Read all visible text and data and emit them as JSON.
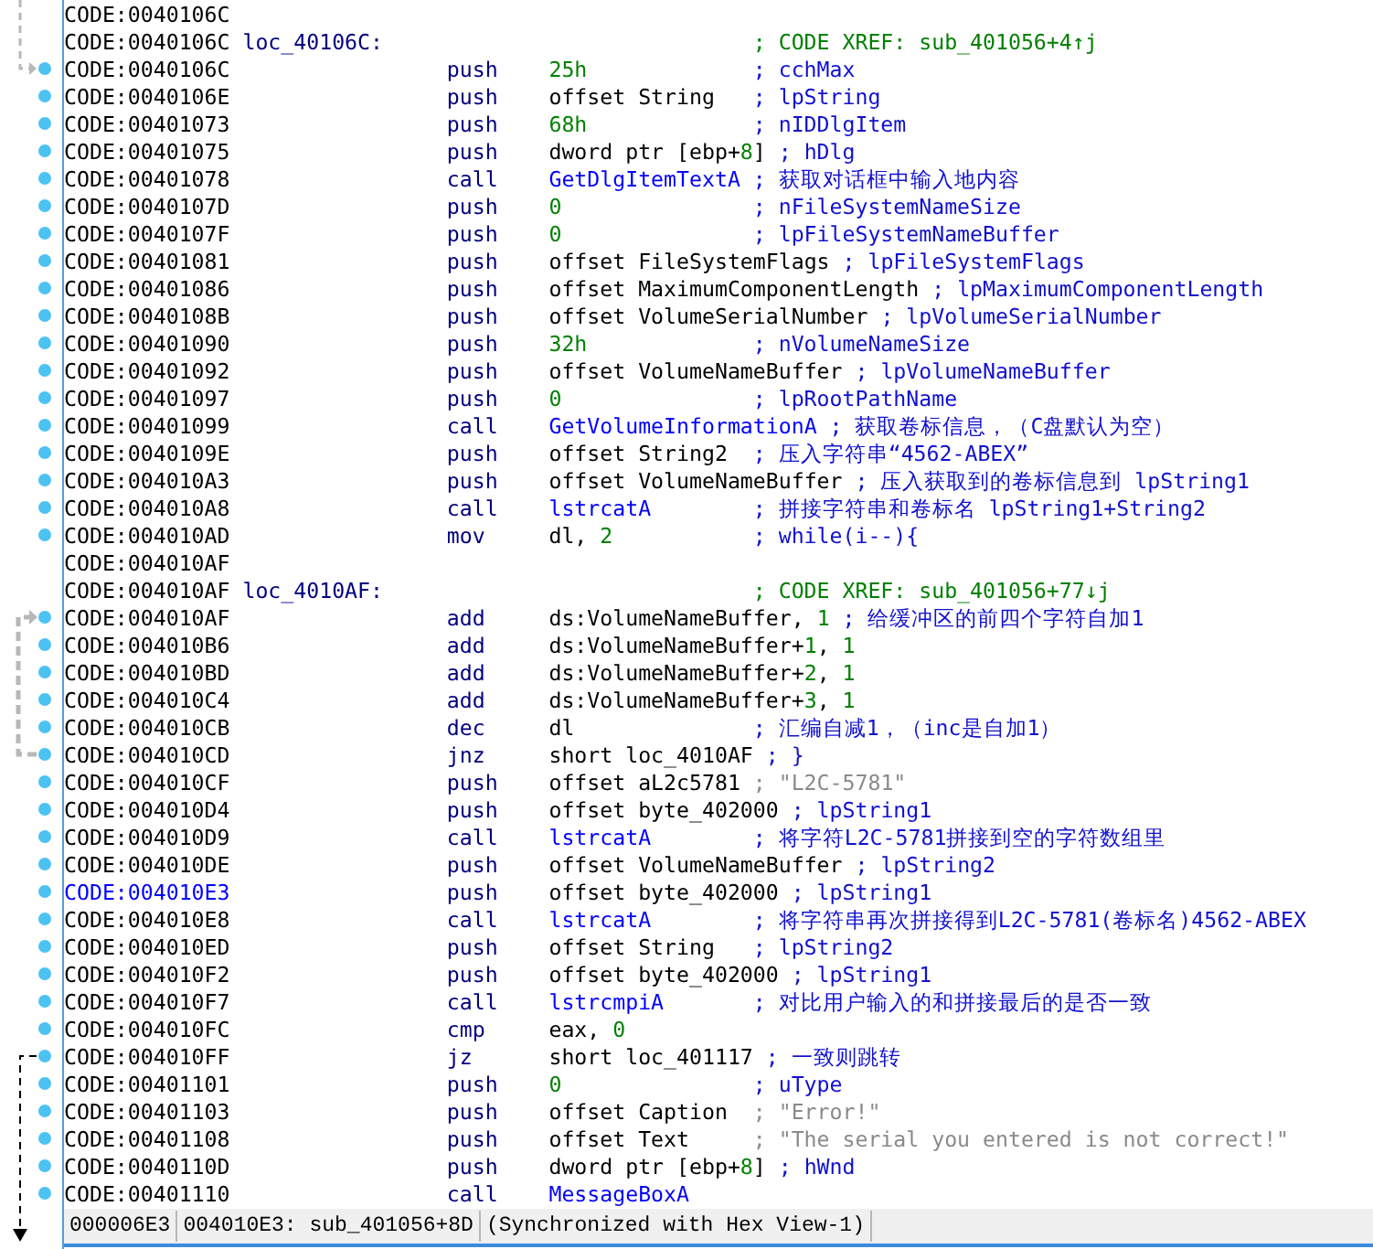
{
  "rows": [
    {
      "address": "CODE:0040106C",
      "selected": false,
      "dot": false
    },
    {
      "address": "CODE:0040106C",
      "selected": false,
      "dot": false,
      "label": "loc_40106C:",
      "comment": {
        "text": "; CODE XREF: sub_401056+4↑j",
        "kind": "xref"
      }
    },
    {
      "address": "CODE:0040106C",
      "selected": false,
      "dot": true,
      "mnemonic": "push",
      "operand": [
        {
          "text": "25h",
          "kind": "number"
        }
      ],
      "comment": {
        "text": "; cchMax",
        "kind": "note"
      }
    },
    {
      "address": "CODE:0040106E",
      "selected": false,
      "dot": true,
      "mnemonic": "push",
      "operand": [
        {
          "text": "offset String",
          "kind": "plain"
        }
      ],
      "comment": {
        "text": "; lpString",
        "kind": "note"
      }
    },
    {
      "address": "CODE:00401073",
      "selected": false,
      "dot": true,
      "mnemonic": "push",
      "operand": [
        {
          "text": "68h",
          "kind": "number"
        }
      ],
      "comment": {
        "text": "; nIDDlgItem",
        "kind": "note"
      }
    },
    {
      "address": "CODE:00401075",
      "selected": false,
      "dot": true,
      "mnemonic": "push",
      "operand": [
        {
          "text": "dword ptr [ebp+",
          "kind": "plain"
        },
        {
          "text": "8",
          "kind": "number"
        },
        {
          "text": "]",
          "kind": "plain"
        }
      ],
      "comment": {
        "text": "; hDlg",
        "kind": "note"
      }
    },
    {
      "address": "CODE:00401078",
      "selected": false,
      "dot": true,
      "mnemonic": "call",
      "operand": [
        {
          "text": "GetDlgItemTextA",
          "kind": "name"
        }
      ],
      "comment": {
        "text": "; 获取对话框中输入地内容",
        "kind": "note"
      }
    },
    {
      "address": "CODE:0040107D",
      "selected": false,
      "dot": true,
      "mnemonic": "push",
      "operand": [
        {
          "text": "0",
          "kind": "number"
        }
      ],
      "comment": {
        "text": "; nFileSystemNameSize",
        "kind": "note"
      }
    },
    {
      "address": "CODE:0040107F",
      "selected": false,
      "dot": true,
      "mnemonic": "push",
      "operand": [
        {
          "text": "0",
          "kind": "number"
        }
      ],
      "comment": {
        "text": "; lpFileSystemNameBuffer",
        "kind": "note"
      }
    },
    {
      "address": "CODE:00401081",
      "selected": false,
      "dot": true,
      "mnemonic": "push",
      "operand": [
        {
          "text": "offset FileSystemFlags",
          "kind": "plain"
        }
      ],
      "comment": {
        "text": "; lpFileSystemFlags",
        "kind": "note"
      }
    },
    {
      "address": "CODE:00401086",
      "selected": false,
      "dot": true,
      "mnemonic": "push",
      "operand": [
        {
          "text": "offset MaximumComponentLength",
          "kind": "plain"
        }
      ],
      "comment": {
        "text": "; lpMaximumComponentLength",
        "kind": "note"
      }
    },
    {
      "address": "CODE:0040108B",
      "selected": false,
      "dot": true,
      "mnemonic": "push",
      "operand": [
        {
          "text": "offset VolumeSerialNumber",
          "kind": "plain"
        }
      ],
      "comment": {
        "text": "; lpVolumeSerialNumber",
        "kind": "note"
      }
    },
    {
      "address": "CODE:00401090",
      "selected": false,
      "dot": true,
      "mnemonic": "push",
      "operand": [
        {
          "text": "32h",
          "kind": "number"
        }
      ],
      "comment": {
        "text": "; nVolumeNameSize",
        "kind": "note"
      }
    },
    {
      "address": "CODE:00401092",
      "selected": false,
      "dot": true,
      "mnemonic": "push",
      "operand": [
        {
          "text": "offset VolumeNameBuffer",
          "kind": "plain"
        }
      ],
      "comment": {
        "text": "; lpVolumeNameBuffer",
        "kind": "note"
      }
    },
    {
      "address": "CODE:00401097",
      "selected": false,
      "dot": true,
      "mnemonic": "push",
      "operand": [
        {
          "text": "0",
          "kind": "number"
        }
      ],
      "comment": {
        "text": "; lpRootPathName",
        "kind": "note"
      }
    },
    {
      "address": "CODE:00401099",
      "selected": false,
      "dot": true,
      "mnemonic": "call",
      "operand": [
        {
          "text": "GetVolumeInformationA",
          "kind": "name"
        }
      ],
      "comment": {
        "text": "; 获取卷标信息，（C盘默认为空）",
        "kind": "note"
      }
    },
    {
      "address": "CODE:0040109E",
      "selected": false,
      "dot": true,
      "mnemonic": "push",
      "operand": [
        {
          "text": "offset String2",
          "kind": "plain"
        }
      ],
      "comment": {
        "text": "; 压入字符串“4562-ABEX”",
        "kind": "note"
      }
    },
    {
      "address": "CODE:004010A3",
      "selected": false,
      "dot": true,
      "mnemonic": "push",
      "operand": [
        {
          "text": "offset VolumeNameBuffer",
          "kind": "plain"
        }
      ],
      "comment": {
        "text": "; 压入获取到的卷标信息到 lpString1",
        "kind": "note"
      }
    },
    {
      "address": "CODE:004010A8",
      "selected": false,
      "dot": true,
      "mnemonic": "call",
      "operand": [
        {
          "text": "lstrcatA",
          "kind": "name"
        }
      ],
      "comment": {
        "text": "; 拼接字符串和卷标名 lpString1+String2",
        "kind": "note"
      }
    },
    {
      "address": "CODE:004010AD",
      "selected": false,
      "dot": true,
      "mnemonic": "mov",
      "operand": [
        {
          "text": "dl, ",
          "kind": "plain"
        },
        {
          "text": "2",
          "kind": "number"
        }
      ],
      "comment": {
        "text": "; while(i--){",
        "kind": "note"
      }
    },
    {
      "address": "CODE:004010AF",
      "selected": false,
      "dot": false
    },
    {
      "address": "CODE:004010AF",
      "selected": false,
      "dot": false,
      "label": "loc_4010AF:",
      "comment": {
        "text": "; CODE XREF: sub_401056+77↓j",
        "kind": "xref"
      }
    },
    {
      "address": "CODE:004010AF",
      "selected": false,
      "dot": true,
      "mnemonic": "add",
      "operand": [
        {
          "text": "ds:VolumeNameBuffer, ",
          "kind": "plain"
        },
        {
          "text": "1",
          "kind": "number"
        }
      ],
      "comment": {
        "text": "; 给缓冲区的前四个字符自加1",
        "kind": "note"
      }
    },
    {
      "address": "CODE:004010B6",
      "selected": false,
      "dot": true,
      "mnemonic": "add",
      "operand": [
        {
          "text": "ds:VolumeNameBuffer+",
          "kind": "plain"
        },
        {
          "text": "1",
          "kind": "number"
        },
        {
          "text": ", ",
          "kind": "plain"
        },
        {
          "text": "1",
          "kind": "number"
        }
      ]
    },
    {
      "address": "CODE:004010BD",
      "selected": false,
      "dot": true,
      "mnemonic": "add",
      "operand": [
        {
          "text": "ds:VolumeNameBuffer+",
          "kind": "plain"
        },
        {
          "text": "2",
          "kind": "number"
        },
        {
          "text": ", ",
          "kind": "plain"
        },
        {
          "text": "1",
          "kind": "number"
        }
      ]
    },
    {
      "address": "CODE:004010C4",
      "selected": false,
      "dot": true,
      "mnemonic": "add",
      "operand": [
        {
          "text": "ds:VolumeNameBuffer+",
          "kind": "plain"
        },
        {
          "text": "3",
          "kind": "number"
        },
        {
          "text": ", ",
          "kind": "plain"
        },
        {
          "text": "1",
          "kind": "number"
        }
      ]
    },
    {
      "address": "CODE:004010CB",
      "selected": false,
      "dot": true,
      "mnemonic": "dec",
      "operand": [
        {
          "text": "dl",
          "kind": "plain"
        }
      ],
      "comment": {
        "text": "; 汇编自减1，（inc是自加1）",
        "kind": "note"
      }
    },
    {
      "address": "CODE:004010CD",
      "selected": false,
      "dot": true,
      "mnemonic": "jnz",
      "operand": [
        {
          "text": "short loc_4010AF",
          "kind": "plain"
        }
      ],
      "comment": {
        "text": "; }",
        "kind": "note"
      }
    },
    {
      "address": "CODE:004010CF",
      "selected": false,
      "dot": true,
      "mnemonic": "push",
      "operand": [
        {
          "text": "offset aL2c5781",
          "kind": "plain"
        }
      ],
      "comment": {
        "text": "; \"L2C-5781\"",
        "kind": "string"
      }
    },
    {
      "address": "CODE:004010D4",
      "selected": false,
      "dot": true,
      "mnemonic": "push",
      "operand": [
        {
          "text": "offset byte_402000",
          "kind": "plain"
        }
      ],
      "comment": {
        "text": "; lpString1",
        "kind": "note"
      }
    },
    {
      "address": "CODE:004010D9",
      "selected": false,
      "dot": true,
      "mnemonic": "call",
      "operand": [
        {
          "text": "lstrcatA",
          "kind": "name"
        }
      ],
      "comment": {
        "text": "; 将字符L2C-5781拼接到空的字符数组里",
        "kind": "note"
      }
    },
    {
      "address": "CODE:004010DE",
      "selected": false,
      "dot": true,
      "mnemonic": "push",
      "operand": [
        {
          "text": "offset VolumeNameBuffer",
          "kind": "plain"
        }
      ],
      "comment": {
        "text": "; lpString2",
        "kind": "note"
      }
    },
    {
      "address": "CODE:004010E3",
      "selected": true,
      "dot": true,
      "mnemonic": "push",
      "operand": [
        {
          "text": "offset byte_402000",
          "kind": "plain"
        }
      ],
      "comment": {
        "text": "; lpString1",
        "kind": "note"
      }
    },
    {
      "address": "CODE:004010E8",
      "selected": false,
      "dot": true,
      "mnemonic": "call",
      "operand": [
        {
          "text": "lstrcatA",
          "kind": "name"
        }
      ],
      "comment": {
        "text": "; 将字符串再次拼接得到L2C-5781(卷标名)4562-ABEX",
        "kind": "note"
      }
    },
    {
      "address": "CODE:004010ED",
      "selected": false,
      "dot": true,
      "mnemonic": "push",
      "operand": [
        {
          "text": "offset String",
          "kind": "plain"
        }
      ],
      "comment": {
        "text": "; lpString2",
        "kind": "note"
      }
    },
    {
      "address": "CODE:004010F2",
      "selected": false,
      "dot": true,
      "mnemonic": "push",
      "operand": [
        {
          "text": "offset byte_402000",
          "kind": "plain"
        }
      ],
      "comment": {
        "text": "; lpString1",
        "kind": "note"
      }
    },
    {
      "address": "CODE:004010F7",
      "selected": false,
      "dot": true,
      "mnemonic": "call",
      "operand": [
        {
          "text": "lstrcmpiA",
          "kind": "name"
        }
      ],
      "comment": {
        "text": "; 对比用户输入的和拼接最后的是否一致",
        "kind": "note"
      }
    },
    {
      "address": "CODE:004010FC",
      "selected": false,
      "dot": true,
      "mnemonic": "cmp",
      "operand": [
        {
          "text": "eax, ",
          "kind": "plain"
        },
        {
          "text": "0",
          "kind": "number"
        }
      ]
    },
    {
      "address": "CODE:004010FF",
      "selected": false,
      "dot": true,
      "mnemonic": "jz",
      "operand": [
        {
          "text": "short loc_401117",
          "kind": "plain"
        }
      ],
      "comment": {
        "text": "; 一致则跳转",
        "kind": "note"
      }
    },
    {
      "address": "CODE:00401101",
      "selected": false,
      "dot": true,
      "mnemonic": "push",
      "operand": [
        {
          "text": "0",
          "kind": "number"
        }
      ],
      "comment": {
        "text": "; uType",
        "kind": "note"
      }
    },
    {
      "address": "CODE:00401103",
      "selected": false,
      "dot": true,
      "mnemonic": "push",
      "operand": [
        {
          "text": "offset Caption",
          "kind": "plain"
        }
      ],
      "comment": {
        "text": "; \"Error!\"",
        "kind": "string"
      }
    },
    {
      "address": "CODE:00401108",
      "selected": false,
      "dot": true,
      "mnemonic": "push",
      "operand": [
        {
          "text": "offset Text",
          "kind": "plain"
        }
      ],
      "comment": {
        "text": "; \"The serial you entered is not correct!\"",
        "kind": "string"
      }
    },
    {
      "address": "CODE:0040110D",
      "selected": false,
      "dot": true,
      "mnemonic": "push",
      "operand": [
        {
          "text": "dword ptr [ebp+",
          "kind": "plain"
        },
        {
          "text": "8",
          "kind": "number"
        },
        {
          "text": "]",
          "kind": "plain"
        }
      ],
      "comment": {
        "text": "; hWnd",
        "kind": "note"
      }
    },
    {
      "address": "CODE:00401110",
      "selected": false,
      "dot": true,
      "mnemonic": "call",
      "operand": [
        {
          "text": "MessageBoxA",
          "kind": "name"
        }
      ]
    }
  ],
  "status_bar": [
    "000006E3",
    "004010E3: sub_401056+8D",
    "(Synchronized with Hex View-1)"
  ]
}
